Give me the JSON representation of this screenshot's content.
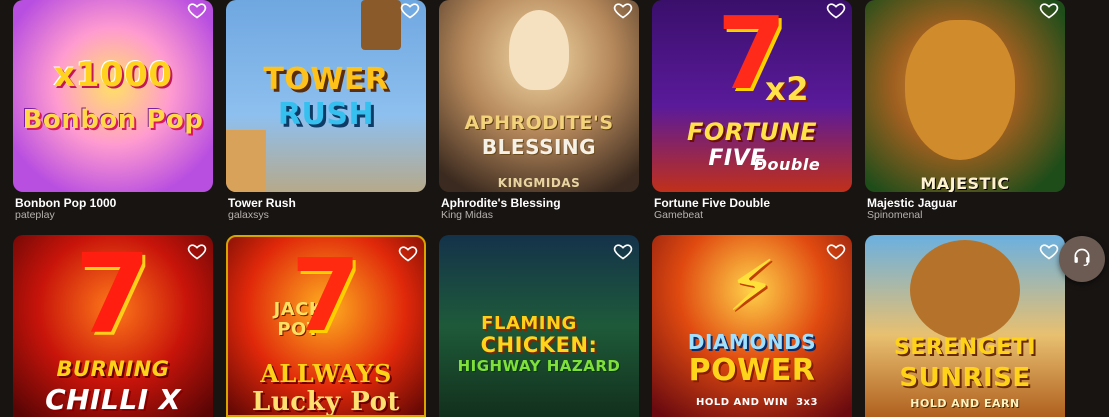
{
  "games": [
    {
      "title": "Bonbon Pop 1000",
      "provider": "pateplay",
      "art": [
        "x1000",
        "Bonbon Pop"
      ]
    },
    {
      "title": "Tower Rush",
      "provider": "galaxsys",
      "art": [
        "TOWER",
        "RUSH"
      ]
    },
    {
      "title": "Aphrodite's Blessing",
      "provider": "King Midas",
      "art": [
        "APHRODITE'S",
        "BLESSING",
        "KINGMIDAS"
      ]
    },
    {
      "title": "Fortune Five Double",
      "provider": "Gamebeat",
      "art": [
        "7",
        "x2",
        "FORTUNE",
        "FIVE",
        "Double"
      ]
    },
    {
      "title": "Majestic Jaguar",
      "provider": "Spinomenal",
      "art": [
        "MAJESTIC"
      ]
    },
    {
      "title": "",
      "provider": "",
      "art": [
        "7",
        "BURNING",
        "CHILLI X"
      ]
    },
    {
      "title": "",
      "provider": "",
      "art": [
        "JACK",
        "POT",
        "7",
        "ALLWAYS",
        "Lucky Pot"
      ]
    },
    {
      "title": "",
      "provider": "",
      "art": [
        "FLAMING",
        "CHICKEN:",
        "HIGHWAY HAZARD"
      ]
    },
    {
      "title": "",
      "provider": "",
      "art": [
        "DIAMONDS",
        "POWER",
        "HOLD AND WIN",
        "3x3"
      ]
    },
    {
      "title": "",
      "provider": "",
      "art": [
        "SERENGETI",
        "SUNRISE",
        "HOLD AND EARN"
      ]
    }
  ],
  "icons": {
    "favorite": "heart-outline-icon",
    "support": "headset-icon"
  }
}
